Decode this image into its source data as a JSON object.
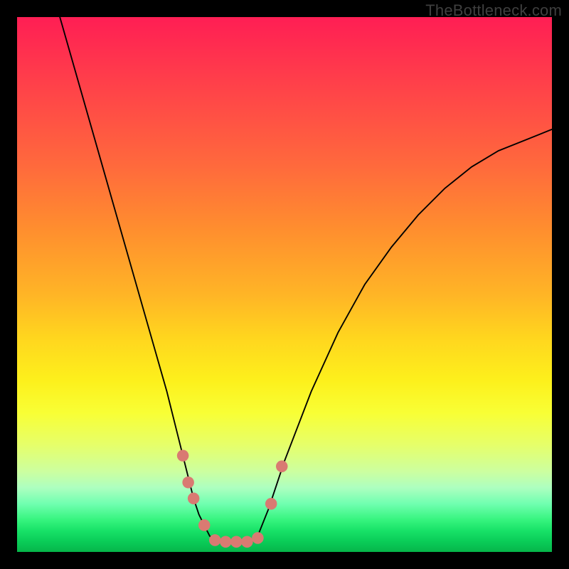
{
  "watermark": "TheBottleneck.com",
  "chart_data": {
    "type": "line",
    "title": "",
    "xlabel": "",
    "ylabel": "",
    "xlim": [
      0,
      100
    ],
    "ylim": [
      0,
      100
    ],
    "grid": false,
    "series": [
      {
        "name": "left-curve",
        "x": [
          8,
          10,
          12,
          14,
          16,
          18,
          20,
          22,
          24,
          26,
          28,
          29,
          30,
          31,
          32,
          33,
          34,
          35,
          36,
          37
        ],
        "y": [
          100,
          93,
          86,
          79,
          72,
          65,
          58,
          51,
          44,
          37,
          30,
          26,
          22,
          18,
          14,
          10,
          7,
          5,
          3,
          2
        ]
      },
      {
        "name": "trough-flat",
        "x": [
          37,
          38,
          39,
          40,
          41,
          42,
          43,
          44,
          45
        ],
        "y": [
          2,
          2,
          2,
          2,
          2,
          2,
          2,
          2,
          3
        ]
      },
      {
        "name": "right-curve",
        "x": [
          45,
          47,
          50,
          55,
          60,
          65,
          70,
          75,
          80,
          85,
          90,
          95,
          100
        ],
        "y": [
          3,
          8,
          17,
          30,
          41,
          50,
          57,
          63,
          68,
          72,
          75,
          77,
          79
        ]
      }
    ],
    "markers": {
      "name": "trough-markers",
      "color": "#d97a72",
      "points": [
        {
          "x": 31,
          "y": 18
        },
        {
          "x": 32,
          "y": 13
        },
        {
          "x": 33,
          "y": 10
        },
        {
          "x": 35,
          "y": 5
        },
        {
          "x": 37,
          "y": 2.2
        },
        {
          "x": 39,
          "y": 1.9
        },
        {
          "x": 41,
          "y": 1.9
        },
        {
          "x": 43,
          "y": 1.9
        },
        {
          "x": 45,
          "y": 2.6
        },
        {
          "x": 47.5,
          "y": 9
        },
        {
          "x": 49.5,
          "y": 16
        }
      ]
    },
    "background_gradient": {
      "top": "#ff1e54",
      "mid": "#ffd61e",
      "bottom": "#06b64a"
    }
  }
}
